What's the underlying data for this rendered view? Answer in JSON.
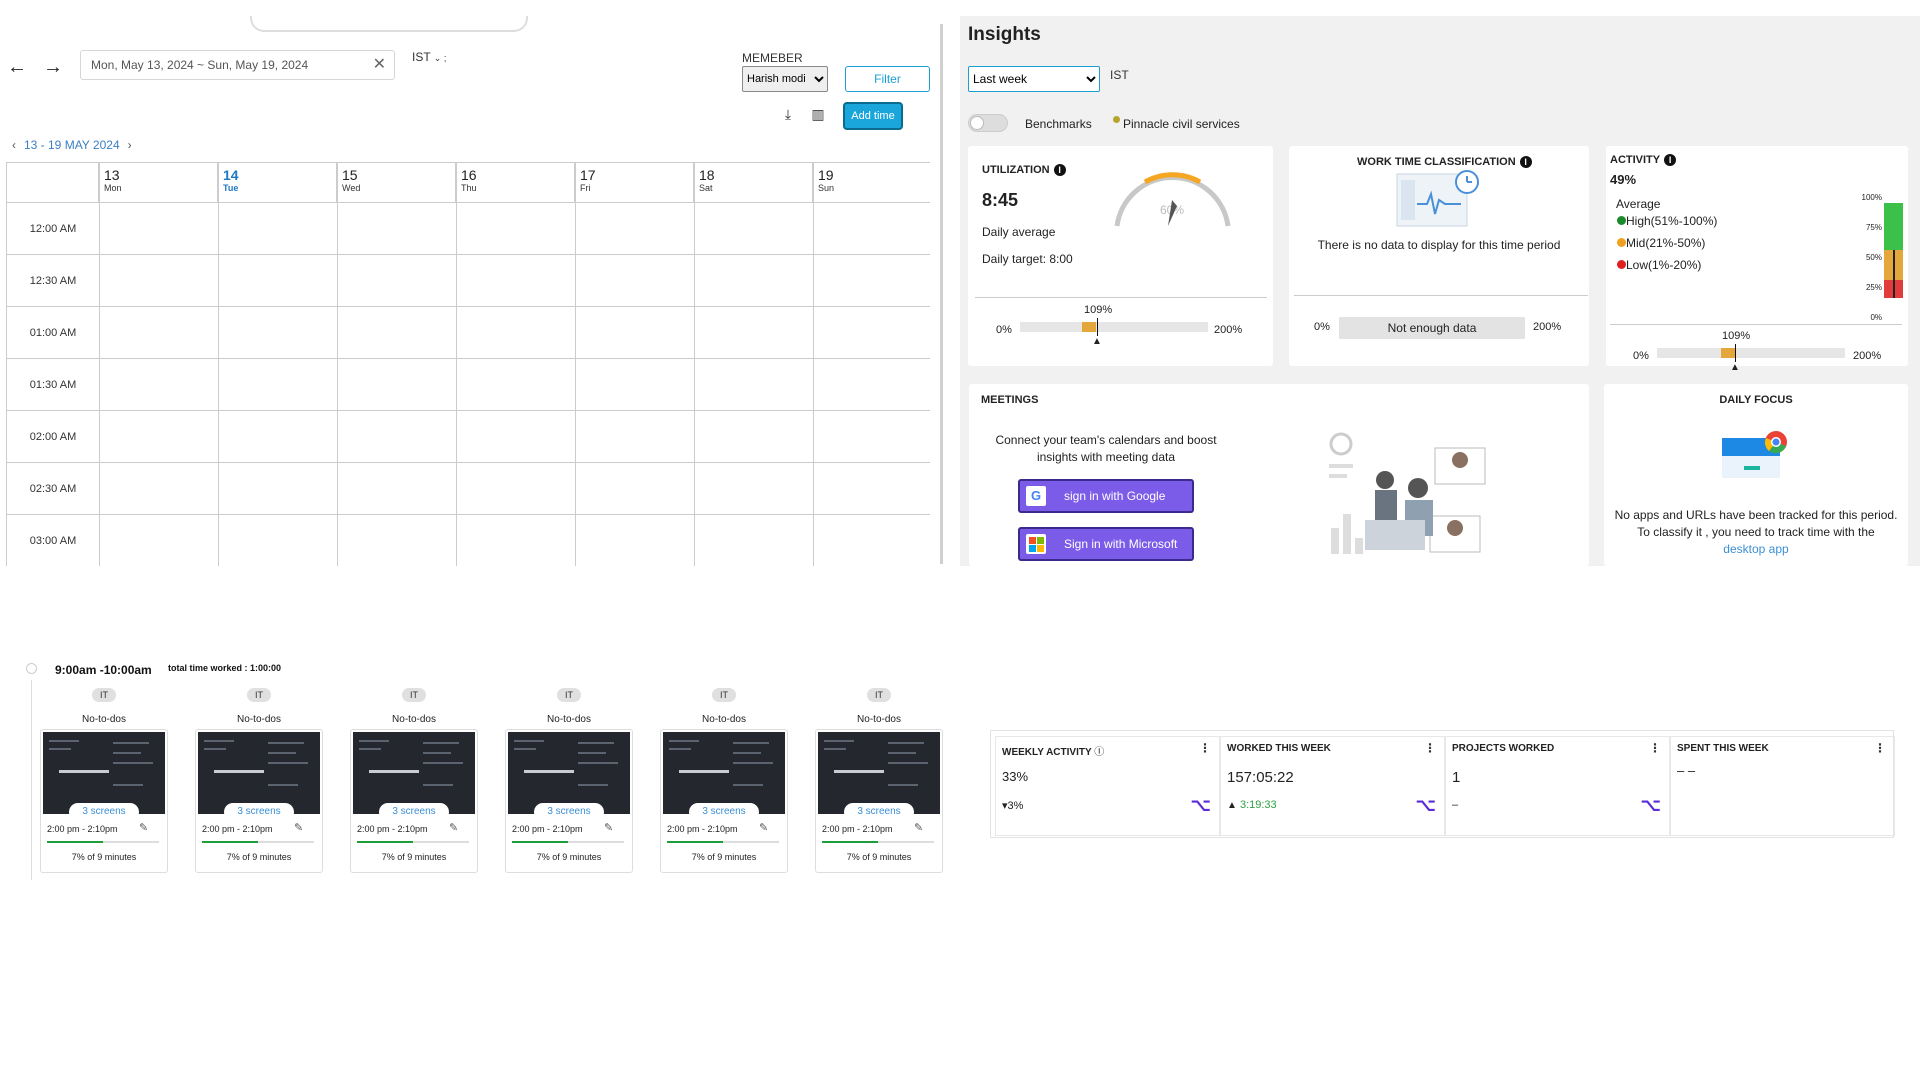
{
  "calendar": {
    "date_range": "Mon, May 13, 2024 ~ Sun, May 19, 2024",
    "clear_symbol": "✕",
    "timezone": "IST",
    "member_label": "MEMEBER",
    "member_selected": "Harish modi",
    "filter_label": "Filter",
    "add_time_label": "Add time",
    "week_label": "13 - 19 MAY 2024",
    "days": [
      {
        "num": "13",
        "name": "Mon"
      },
      {
        "num": "14",
        "name": "Tue"
      },
      {
        "num": "15",
        "name": "Wed"
      },
      {
        "num": "16",
        "name": "Thu"
      },
      {
        "num": "17",
        "name": "Fri"
      },
      {
        "num": "18",
        "name": "Sat"
      },
      {
        "num": "19",
        "name": "Sun"
      }
    ],
    "times": [
      "12:00 AM",
      "12:30 AM",
      "01:00 AM",
      "01:30 AM",
      "02:00 AM",
      "02:30 AM",
      "03:00 AM"
    ]
  },
  "insights": {
    "title": "Insights",
    "period_selected": "Last week",
    "timezone": "IST",
    "benchmarks_label": "Benchmarks",
    "company": "Pinnacle civil services",
    "utilization": {
      "title": "UTILIZATION",
      "value": "8:45",
      "daily_average": "Daily average",
      "daily_target": "Daily target: 8:00",
      "gauge_text": "60%",
      "percent": "109%",
      "min": "0%",
      "max": "200%"
    },
    "work_time": {
      "title": "WORK TIME CLASSIFICATION",
      "empty_message": "There is no data to display for this time period",
      "min": "0%",
      "bar_label": "Not enough data",
      "max": "200%"
    },
    "activity": {
      "title": "ACTIVITY",
      "value": "49%",
      "average_label": "Average",
      "legend": [
        {
          "label": "High(51%-100%)",
          "color": "#1a8a2a"
        },
        {
          "label": "Mid(21%-50%)",
          "color": "#f0a020"
        },
        {
          "label": "Low(1%-20%)",
          "color": "#e02020"
        }
      ],
      "ticks": [
        "100%",
        "75%",
        "50%",
        "25%",
        "0%"
      ],
      "percent": "109%",
      "min": "0%",
      "max": "200%"
    },
    "meetings": {
      "title": "MEETINGS",
      "text": "Connect your team's calendars and boost insights with meeting data",
      "google_label": "sign in with Google",
      "microsoft_label": "Sign in with Microsoft"
    },
    "daily_focus": {
      "title": "DAILY FOCUS",
      "text": "No apps and URLs have been tracked for this period. To classify it , you need to track time with the",
      "link": "desktop app"
    }
  },
  "activity_log": {
    "slot_time": "9:00am -10:00am",
    "total_worked": "total time worked : 1:00:00",
    "items": [
      {
        "tag": "IT",
        "todo": "No-to-dos",
        "screens": "3 screens",
        "range": "2:00 pm - 2:10pm",
        "percent_text": "7% of 9 minutes",
        "progress": 0.5
      },
      {
        "tag": "IT",
        "todo": "No-to-dos",
        "screens": "3 screens",
        "range": "2:00 pm - 2:10pm",
        "percent_text": "7% of 9 minutes",
        "progress": 0.5
      },
      {
        "tag": "IT",
        "todo": "No-to-dos",
        "screens": "3 screens",
        "range": "2:00 pm - 2:10pm",
        "percent_text": "7% of 9 minutes",
        "progress": 0.5
      },
      {
        "tag": "IT",
        "todo": "No-to-dos",
        "screens": "3 screens",
        "range": "2:00 pm - 2:10pm",
        "percent_text": "7% of 9 minutes",
        "progress": 0.5
      },
      {
        "tag": "IT",
        "todo": "No-to-dos",
        "screens": "3 screens",
        "range": "2:00 pm - 2:10pm",
        "percent_text": "7% of 9 minutes",
        "progress": 0.5
      },
      {
        "tag": "IT",
        "todo": "No-to-dos",
        "screens": "3 screens",
        "range": "2:00 pm - 2:10pm",
        "percent_text": "7% of 9 minutes",
        "progress": 0.5
      }
    ]
  },
  "weekly_stats": {
    "weekly_activity": {
      "title": "WEEKLY ACTIVITY",
      "value": "33%",
      "sub": "▾3%"
    },
    "worked_this_week": {
      "title": "WORKED THIS WEEK",
      "value": "157:05:22",
      "sub": "3:19:33"
    },
    "projects_worked": {
      "title": "PROJECTS WORKED",
      "value": "1",
      "sub": "–"
    },
    "spent_this_week": {
      "title": "SPENT THIS WEEK",
      "value": "– –"
    }
  }
}
